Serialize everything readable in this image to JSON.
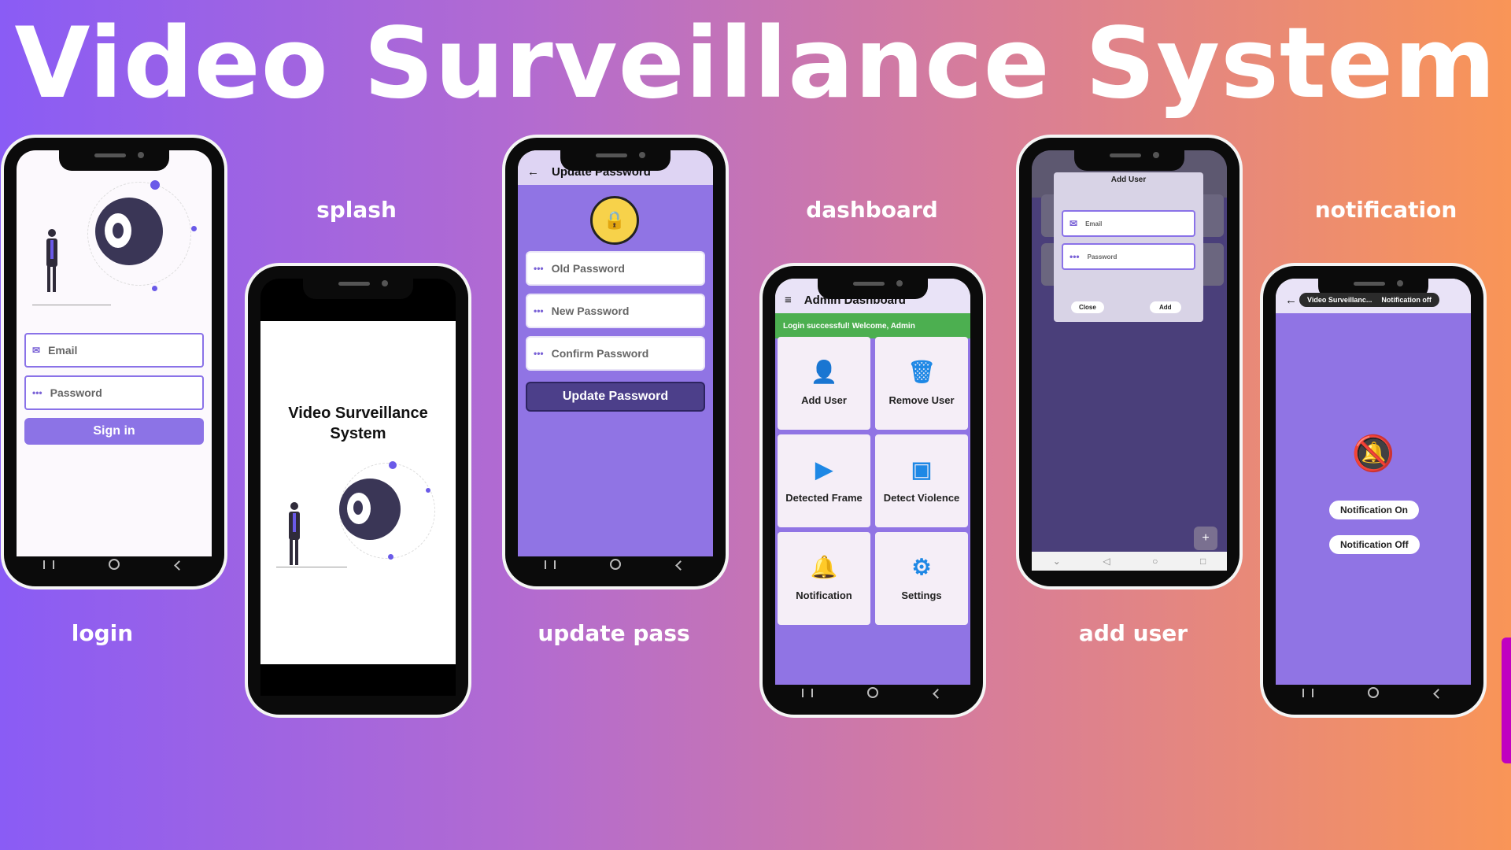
{
  "title": "Video Surveillance System",
  "captions": {
    "splash": "splash",
    "dashboard": "dashboard",
    "notification": "notification",
    "login": "login",
    "update_pass": "update pass",
    "add_user": "add user"
  },
  "login": {
    "email_placeholder": "Email",
    "password_placeholder": "Password",
    "signin_label": "Sign in"
  },
  "splash": {
    "app_name": "Video Surveillance System"
  },
  "update_password": {
    "appbar_title": "Update Password",
    "old_password": "Old Password",
    "new_password": "New Password",
    "confirm_password": "Confirm Password",
    "button_label": "Update Password"
  },
  "dashboard": {
    "appbar_title": "Admin Dashboard",
    "toast": "Login successful! Welcome, Admin",
    "cards": [
      {
        "label": "Add User",
        "icon": "add-person-icon"
      },
      {
        "label": "Remove User",
        "icon": "trash-icon"
      },
      {
        "label": "Detected Frame",
        "icon": "play-icon"
      },
      {
        "label": "Detect Violence",
        "icon": "video-library-icon"
      },
      {
        "label": "Notification",
        "icon": "bell-icon"
      },
      {
        "label": "Settings",
        "icon": "gear-icon"
      }
    ]
  },
  "add_user": {
    "dialog_title": "Add User",
    "email_placeholder": "Email",
    "password_placeholder": "Password",
    "close_label": "Close",
    "add_label": "Add",
    "fab_label": "+"
  },
  "notification": {
    "toast_app": "Video Surveillanc...",
    "toast_text": "Notification off",
    "on_label": "Notification On",
    "off_label": "Notification Off"
  },
  "colors": {
    "accent": "#8c73e6",
    "toast_green": "#4caf50",
    "icon_blue": "#1e88e5",
    "dark_button": "#4c3f8a"
  }
}
